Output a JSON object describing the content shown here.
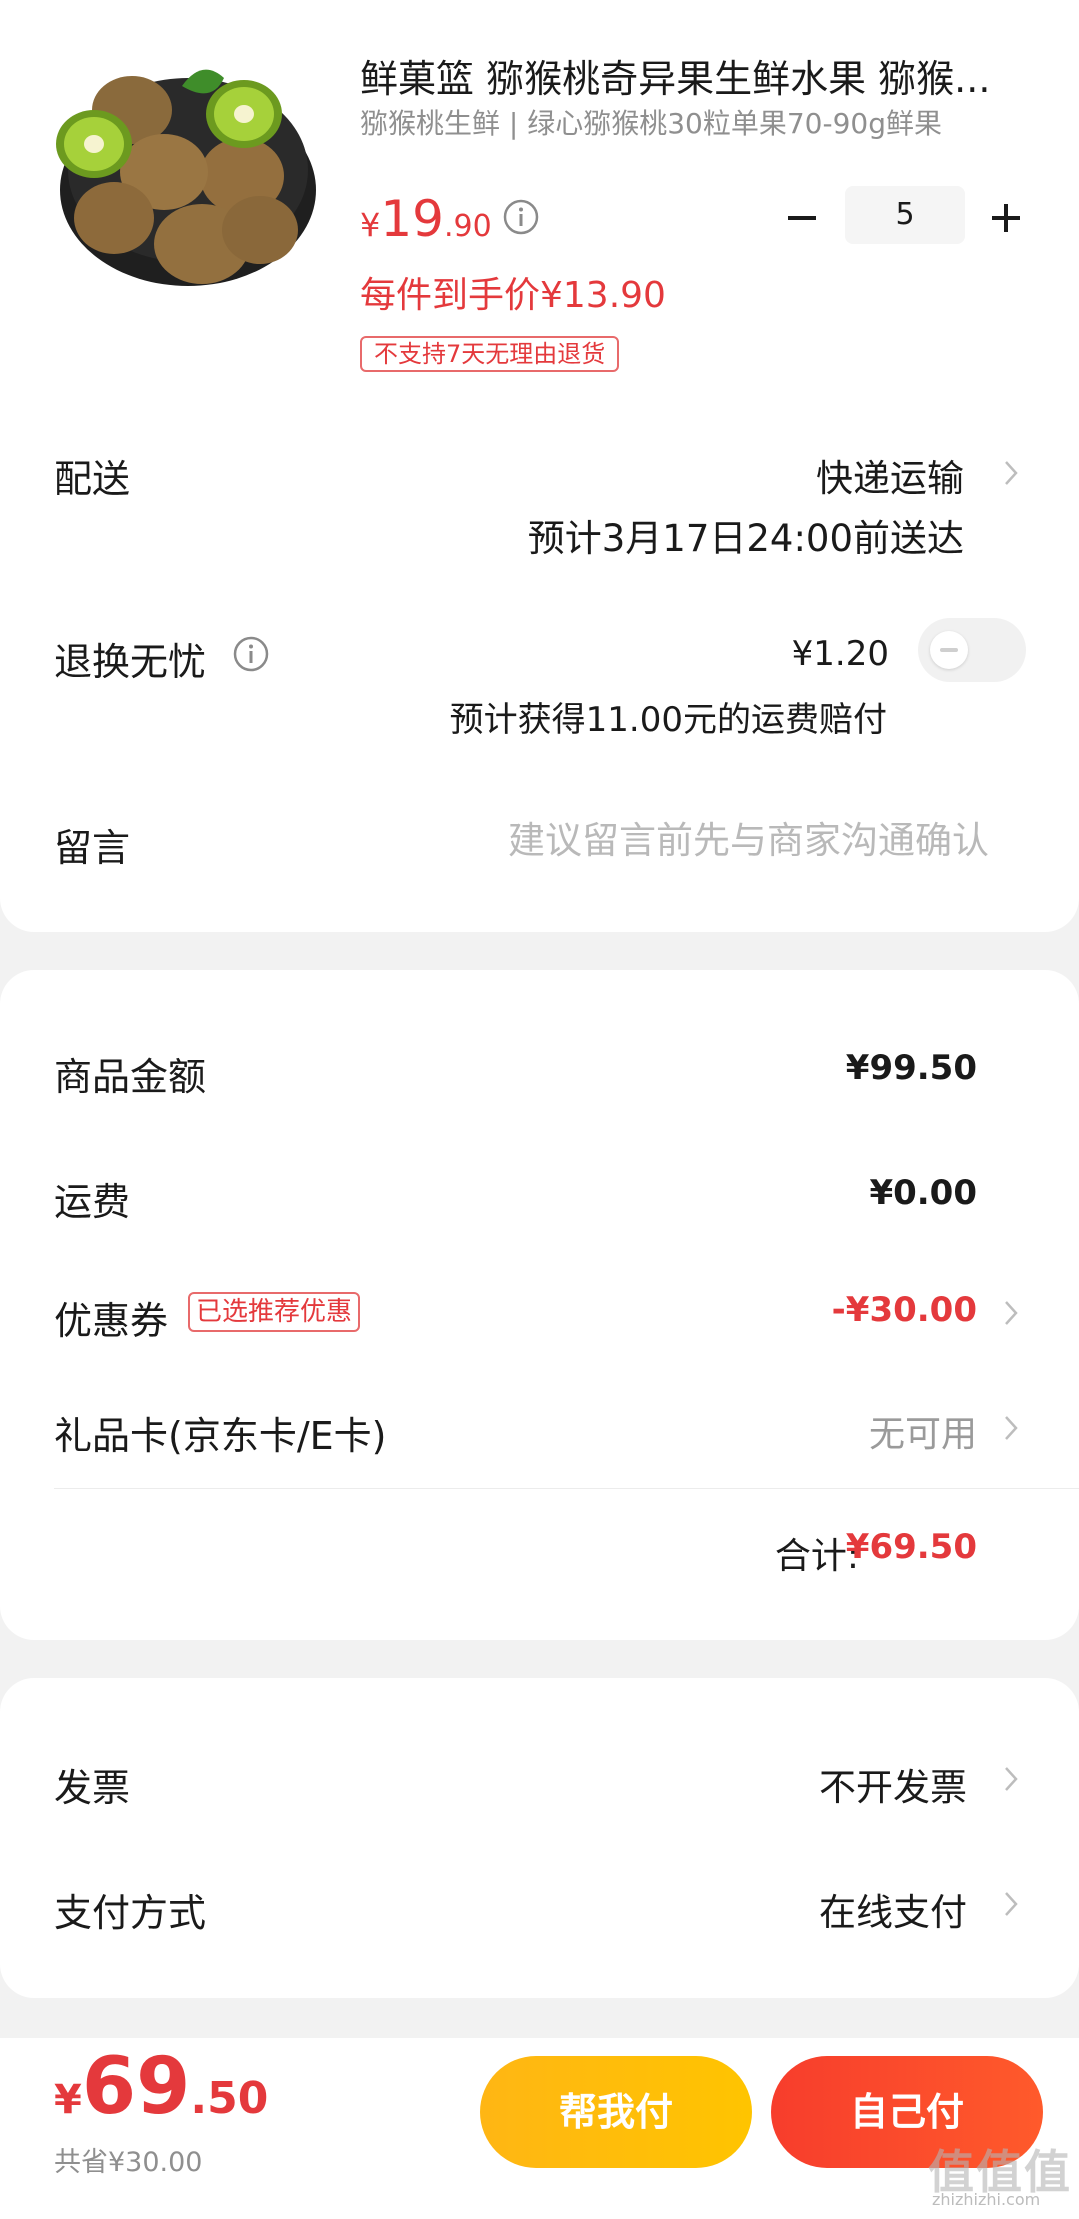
{
  "product": {
    "title": "鲜菓篮 猕猴桃奇异果生鲜水果 猕猴...",
    "subtitle": "猕猴桃生鲜 | 绿心猕猴桃30粒单果70-90g鲜果",
    "price_currency": "¥",
    "price_int": "19",
    "price_dec": ".90",
    "final_price": "每件到手价¥13.90",
    "return_policy_tag": "不支持7天无理由退货",
    "quantity": "5"
  },
  "delivery": {
    "label": "配送",
    "method": "快递运输",
    "eta": "预计3月17日24:00前送达"
  },
  "return_service": {
    "label": "退换无忧",
    "price": "¥1.20",
    "description": "预计获得11.00元的运费赔付",
    "enabled": false
  },
  "message": {
    "label": "留言",
    "placeholder": "建议留言前先与商家沟通确认"
  },
  "summary": {
    "subtotal_label": "商品金额",
    "subtotal_value": "¥99.50",
    "shipping_label": "运费",
    "shipping_value": "¥0.00",
    "coupon_label": "优惠券",
    "coupon_tag": "已选推荐优惠",
    "coupon_value": "-¥30.00",
    "giftcard_label": "礼品卡(京东卡/E卡)",
    "giftcard_value": "无可用",
    "total_label": "合计:",
    "total_value": "¥69.50"
  },
  "invoice": {
    "label": "发票",
    "value": "不开发票"
  },
  "payment": {
    "label": "支付方式",
    "value": "在线支付"
  },
  "bottom_bar": {
    "price_currency": "¥",
    "price_int": "69",
    "price_dec": ".50",
    "savings": "共省¥30.00",
    "help_pay_label": "帮我付",
    "self_pay_label": "自己付"
  },
  "watermark": {
    "text": "值值值",
    "url": "zhizhizhi.com"
  },
  "colors": {
    "accent_red": "#e4393c",
    "help_pay_yellow": "#ffb614",
    "self_pay_red": "#f73d2c"
  }
}
